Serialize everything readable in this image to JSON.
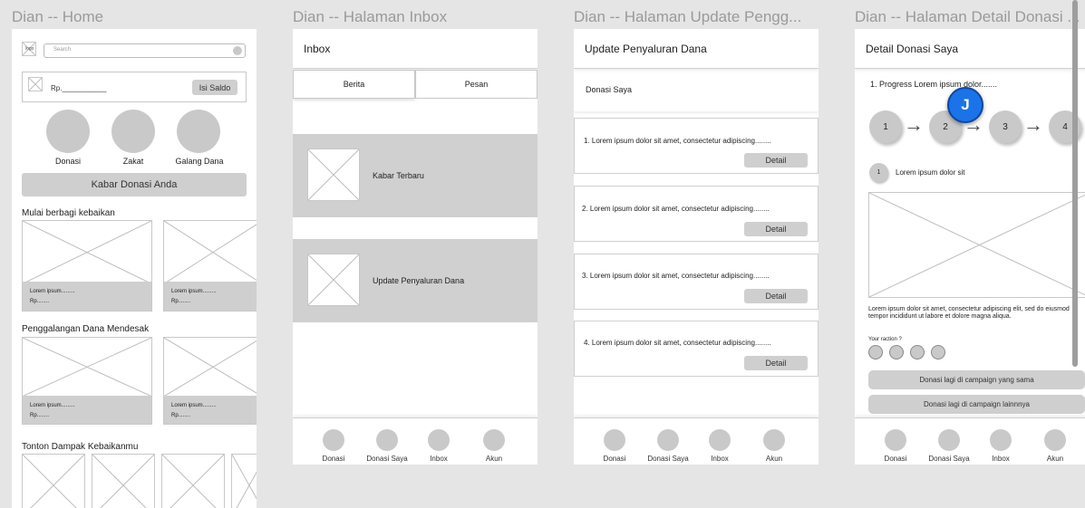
{
  "frames": {
    "home": {
      "title": "Dian -- Home",
      "search_placeholder": "Search",
      "logo_text": "logo",
      "balance_label": "Rp.___________",
      "topup_label": "Isi Saldo",
      "categories": [
        "Donasi",
        "Zakat",
        "Galang Dana"
      ],
      "news_button": "Kabar Donasi Anda",
      "section1": "Mulai berbagi kebaikan",
      "section2": "Penggalangan Dana Mendesak",
      "section3": "Tonton Dampak Kebaikanmu",
      "card_title": "Lorem ipsum.........",
      "card_price": "Rp........"
    },
    "inbox": {
      "title": "Dian -- Halaman Inbox",
      "header": "Inbox",
      "tab1": "Berita",
      "tab2": "Pesan",
      "item1": "Kabar Terbaru",
      "item2": "Update Penyaluran Dana"
    },
    "update": {
      "title": "Dian -- Halaman Update Pengg...",
      "header": "Update Penyaluran Dana",
      "sub": "Donasi Saya",
      "items": [
        "1. Lorem ipsum dolor sit amet, consectetur adipiscing........",
        "2. Lorem ipsum dolor sit amet, consectetur adipiscing........",
        "3. Lorem ipsum dolor sit amet, consectetur adipiscing........",
        "4. Lorem ipsum dolor sit amet, consectetur adipiscing........"
      ],
      "detail_label": "Detail"
    },
    "detail": {
      "title": "Dian -- Halaman Detail Donasi ...",
      "header": "Detail Donasi Saya",
      "progress": "1. Progress Lorem ipsum dolor.......",
      "steps": [
        "1",
        "2",
        "3",
        "4"
      ],
      "step_label": "Lorem ipsum dolor sit",
      "step_number": "1",
      "description": "Lorem ipsum dolor sit amet, consectetur adipiscing elit, sed do eiusmod tempor incididunt ut labore et dolore magna aliqua.",
      "reaction": "Your raction ?",
      "btn1": "Donasi lagi di campaign yang sama",
      "btn2": "Donasi lagi di campaign lainnnya",
      "avatar_letter": "J"
    }
  },
  "nav": [
    "Donasi",
    "Donasi Saya",
    "Inbox",
    "Akun"
  ],
  "colors": {
    "background": "#e5e5e5",
    "avatar": "#1a73e8",
    "placeholder": "#cfcfcf"
  }
}
